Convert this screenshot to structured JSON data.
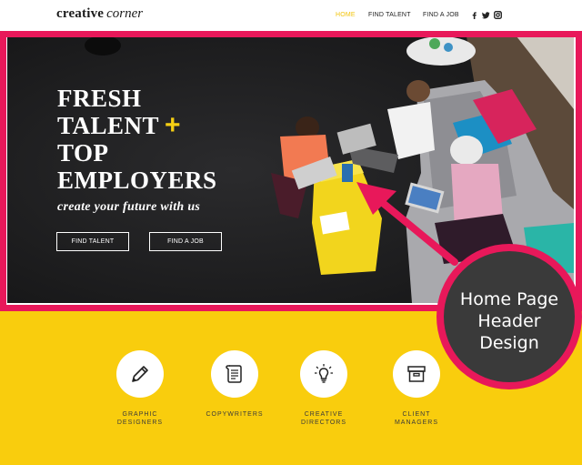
{
  "header": {
    "logo_bold": "creative",
    "logo_italic": "corner",
    "nav": [
      "HOME",
      "FIND TALENT",
      "FIND A JOB"
    ],
    "social_icons": [
      "facebook-icon",
      "twitter-icon",
      "instagram-icon"
    ]
  },
  "hero": {
    "headline": [
      "FRESH",
      "TALENT",
      "TOP",
      "EMPLOYERS"
    ],
    "plus": "+",
    "tagline": "create your future with us",
    "buttons": [
      "FIND TALENT",
      "FIND A JOB"
    ]
  },
  "services": [
    {
      "icon": "pencil-icon",
      "label_lines": [
        "GRAPHIC",
        "DESIGNERS"
      ]
    },
    {
      "icon": "scroll-icon",
      "label_lines": [
        "COPYWRITERS"
      ]
    },
    {
      "icon": "lightbulb-icon",
      "label_lines": [
        "CREATIVE",
        "DIRECTORS"
      ]
    },
    {
      "icon": "filing-box-icon",
      "label_lines": [
        "CLIENT",
        "MANAGERS"
      ]
    }
  ],
  "callout": {
    "lines": [
      "Home Page",
      "Header",
      "Design"
    ]
  },
  "colors": {
    "accent_yellow": "#f9cd0d",
    "frame_pink": "#e8185a",
    "callout_gray": "#3a3a3a"
  }
}
